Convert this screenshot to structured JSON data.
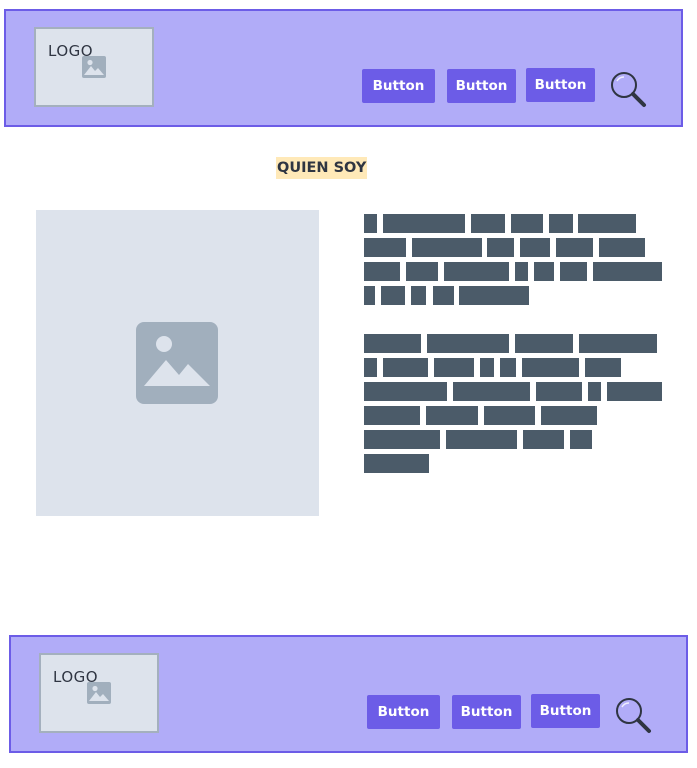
{
  "header": {
    "logo": {
      "label": "LOGO"
    },
    "buttons": [
      {
        "label": "Button"
      },
      {
        "label": "Button"
      },
      {
        "label": "Button"
      }
    ],
    "search_icon": "search-icon"
  },
  "main": {
    "section_title": "QUIEN SOY",
    "image_icon": "image-placeholder-icon",
    "text_placeholder": "redacted-text-blocks"
  },
  "footer": {
    "logo": {
      "label": "LOGO"
    },
    "buttons": [
      {
        "label": "Button"
      },
      {
        "label": "Button"
      },
      {
        "label": "Button"
      }
    ],
    "search_icon": "search-icon"
  },
  "colors": {
    "bar_bg": "#b1acf8",
    "bar_border": "#6c5ce7",
    "button_bg": "#6c5ce7",
    "placeholder_bg": "#dde3ec",
    "placeholder_icon": "#a1afbd",
    "text_block": "#4b5b69",
    "heading_highlight": "#ffe9b8"
  }
}
